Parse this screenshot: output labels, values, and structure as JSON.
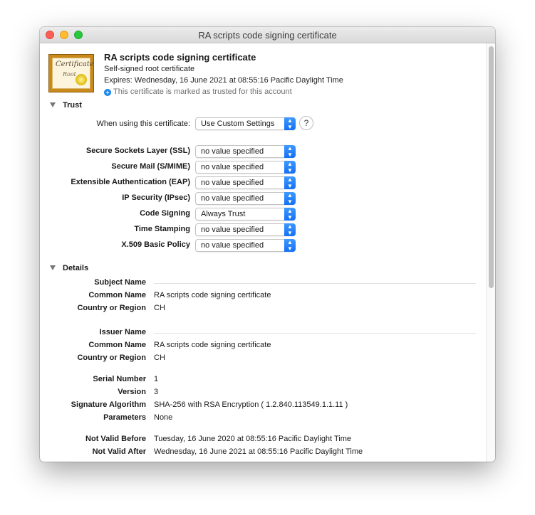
{
  "window": {
    "title": "RA scripts code signing certificate"
  },
  "header": {
    "cert_name": "RA scripts code signing certificate",
    "subtitle": "Self-signed root certificate",
    "expires": "Expires: Wednesday, 16 June 2021 at 08:55:16 Pacific Daylight Time",
    "trusted_note": "This certificate is marked as trusted for this account",
    "icon_text_1": "Certificate",
    "icon_text_2": "Root"
  },
  "trust": {
    "section_label": "Trust",
    "when_using_label": "When using this certificate:",
    "when_using_value": "Use Custom Settings",
    "help_label": "?",
    "policies": [
      {
        "label": "Secure Sockets Layer (SSL)",
        "value": "no value specified"
      },
      {
        "label": "Secure Mail (S/MIME)",
        "value": "no value specified"
      },
      {
        "label": "Extensible Authentication (EAP)",
        "value": "no value specified"
      },
      {
        "label": "IP Security (IPsec)",
        "value": "no value specified"
      },
      {
        "label": "Code Signing",
        "value": "Always Trust"
      },
      {
        "label": "Time Stamping",
        "value": "no value specified"
      },
      {
        "label": "X.509 Basic Policy",
        "value": "no value specified"
      }
    ]
  },
  "details": {
    "section_label": "Details",
    "rows": [
      {
        "label": "Subject Name",
        "value": ""
      },
      {
        "label": "Common Name",
        "value": "RA scripts code signing certificate"
      },
      {
        "label": "Country or Region",
        "value": "CH"
      },
      {
        "label": "Issuer Name",
        "value": ""
      },
      {
        "label": "Common Name",
        "value": "RA scripts code signing certificate"
      },
      {
        "label": "Country or Region",
        "value": "CH"
      },
      {
        "label": "Serial Number",
        "value": "1"
      },
      {
        "label": "Version",
        "value": "3"
      },
      {
        "label": "Signature Algorithm",
        "value": "SHA-256 with RSA Encryption ( 1.2.840.113549.1.1.11 )"
      },
      {
        "label": "Parameters",
        "value": "None"
      },
      {
        "label": "Not Valid Before",
        "value": "Tuesday, 16 June 2020 at 08:55:16 Pacific Daylight Time"
      },
      {
        "label": "Not Valid After",
        "value": "Wednesday, 16 June 2021 at 08:55:16 Pacific Daylight Time"
      }
    ]
  },
  "colors": {
    "accent": "#1b86e8",
    "close": "#fd5f57",
    "minimize": "#febc2e",
    "zoom": "#28c840"
  }
}
